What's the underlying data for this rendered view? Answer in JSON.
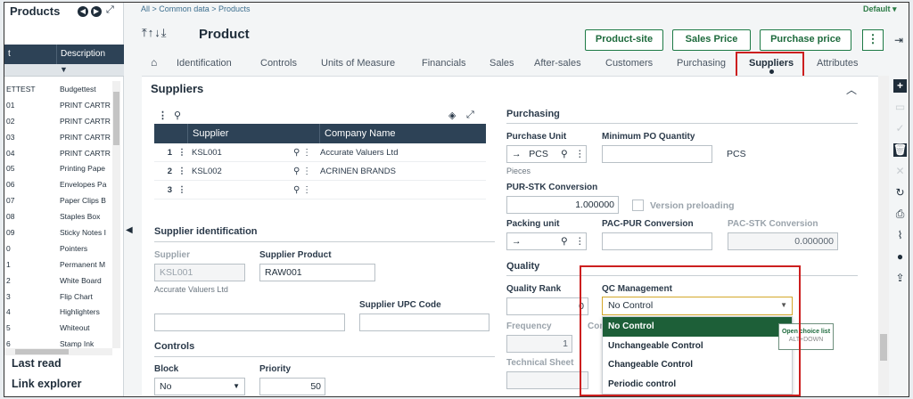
{
  "left_panel": {
    "title": "Products",
    "columns": [
      "t",
      "Description"
    ],
    "rows": [
      [
        "ETTEST",
        "Budgettest"
      ],
      [
        "01",
        "PRINT CARTR"
      ],
      [
        "02",
        "PRINT CARTR"
      ],
      [
        "03",
        "PRINT CARTR"
      ],
      [
        "04",
        "PRINT CARTR"
      ],
      [
        "05",
        "Printing Pape"
      ],
      [
        "06",
        "Envelopes Pa"
      ],
      [
        "07",
        "Paper Clips B"
      ],
      [
        "08",
        "Staples Box"
      ],
      [
        "09",
        "Sticky Notes I"
      ],
      [
        "0",
        "Pointers"
      ],
      [
        "1",
        "Permanent M"
      ],
      [
        "2",
        "White Board"
      ],
      [
        "3",
        "Flip Chart"
      ],
      [
        "4",
        "Highlighters"
      ],
      [
        "5",
        "Whiteout"
      ],
      [
        "6",
        "Stamp Ink"
      ]
    ],
    "last_read": "Last read",
    "link_explorer": "Link explorer"
  },
  "breadcrumb": "All  >  Common data  >  Products",
  "default_label": "Default",
  "page_title": "Product",
  "header_buttons": {
    "product_site": "Product-site",
    "sales_price": "Sales Price",
    "purchase_price": "Purchase price"
  },
  "tabs": [
    "Identification",
    "Controls",
    "Units of Measure",
    "Financials",
    "Sales",
    "After-sales",
    "Customers",
    "Purchasing",
    "Suppliers",
    "Attributes"
  ],
  "section_title": "Suppliers",
  "supplier_grid": {
    "columns": [
      "Supplier",
      "Company Name"
    ],
    "rows": [
      {
        "num": "1",
        "supplier": "KSL001",
        "company": "Accurate Valuers Ltd"
      },
      {
        "num": "2",
        "supplier": "KSL002",
        "company": "ACRINEN BRANDS"
      },
      {
        "num": "3",
        "supplier": "",
        "company": ""
      }
    ]
  },
  "supplier_identification": {
    "heading": "Supplier identification",
    "supplier_label": "Supplier",
    "supplier_value": "KSL001",
    "supplier_sub": "Accurate Valuers Ltd",
    "supplier_product_label": "Supplier Product",
    "supplier_product_value": "RAW001",
    "upc_label": "Supplier UPC Code",
    "upc_value": ""
  },
  "controls": {
    "heading": "Controls",
    "block_label": "Block",
    "block_value": "No",
    "priority_label": "Priority",
    "priority_value": "50"
  },
  "purchasing": {
    "heading": "Purchasing",
    "purchase_unit_label": "Purchase Unit",
    "purchase_unit_value": "PCS",
    "purchase_unit_sub": "Pieces",
    "min_po_label": "Minimum PO Quantity",
    "min_po_value": "",
    "min_po_unit": "PCS",
    "pur_stk_label": "PUR-STK Conversion",
    "pur_stk_value": "1.000000",
    "version_preloading": "Version preloading",
    "packing_unit_label": "Packing unit",
    "packing_unit_value": "",
    "pac_pur_label": "PAC-PUR Conversion",
    "pac_pur_value": "",
    "pac_stk_label": "PAC-STK Conversion",
    "pac_stk_value": "0.000000"
  },
  "quality": {
    "heading": "Quality",
    "quality_rank_label": "Quality Rank",
    "quality_rank_value": "0",
    "frequency_label": "Frequency",
    "frequency_value": "1",
    "co_label": "Con",
    "technical_sheet_label": "Technical Sheet",
    "qc_label": "QC Management",
    "qc_value": "No Control",
    "qc_options": [
      "No Control",
      "Unchangeable Control",
      "Changeable Control",
      "Periodic control"
    ],
    "tooltip_line1": "Open choice list",
    "tooltip_line2": "ALT+DOWN"
  },
  "colors": {
    "grid_header": "#2d4256",
    "accent_green": "#1d7a45",
    "highlight_red": "#cc1f1f",
    "selected_option": "#1d5f38"
  }
}
